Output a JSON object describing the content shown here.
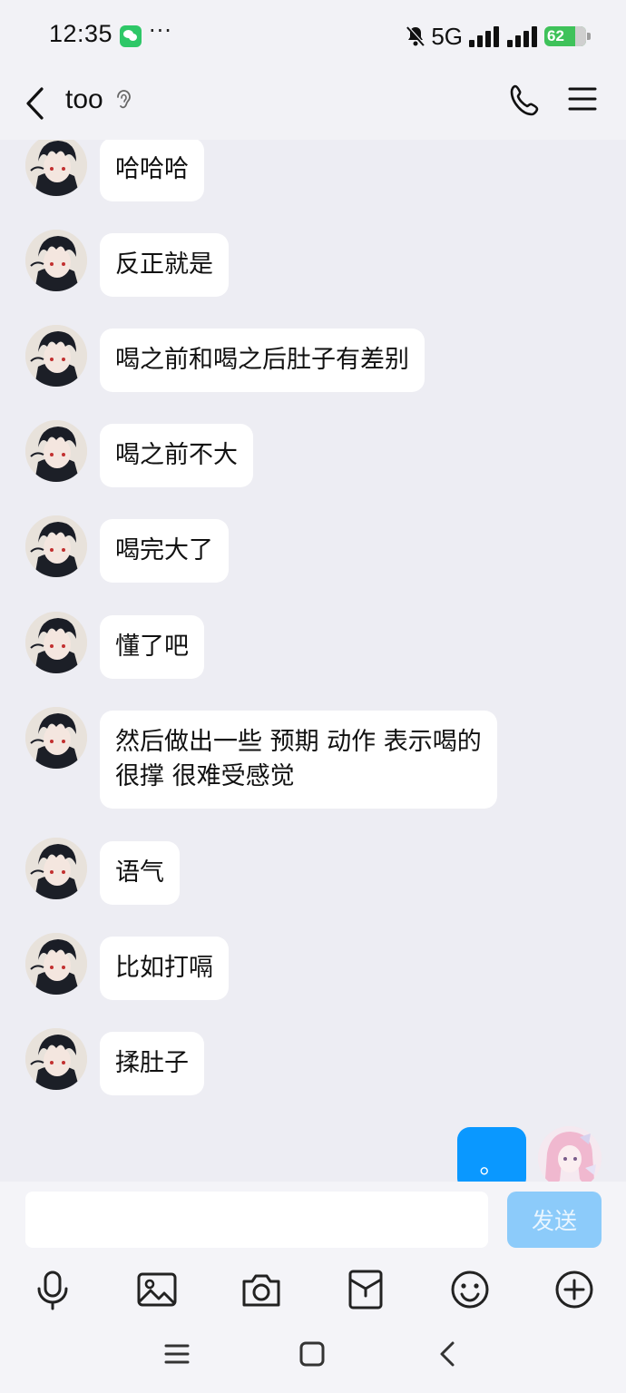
{
  "status_bar": {
    "time": "12:35",
    "dots": "···",
    "network": "5G",
    "battery": "62"
  },
  "header": {
    "title": "too"
  },
  "messages": [
    {
      "text": "哈哈哈"
    },
    {
      "text": "反正就是"
    },
    {
      "text": "喝之前和喝之后肚子有差别"
    },
    {
      "text": "喝之前不大"
    },
    {
      "text": "喝完大了"
    },
    {
      "text": "懂了吧"
    },
    {
      "text": "然后做出一些 预期 动作 表示喝的\n很撑 很难受感觉"
    },
    {
      "text": "语气"
    },
    {
      "text": "比如打嗝"
    },
    {
      "text": "揉肚子"
    }
  ],
  "self_message": {
    "text": "。"
  },
  "input": {
    "value": "",
    "send_label": "发送"
  },
  "colors": {
    "accent": "#0a98ff",
    "send_disabled": "#8ccbfa",
    "background": "#ededf3"
  }
}
